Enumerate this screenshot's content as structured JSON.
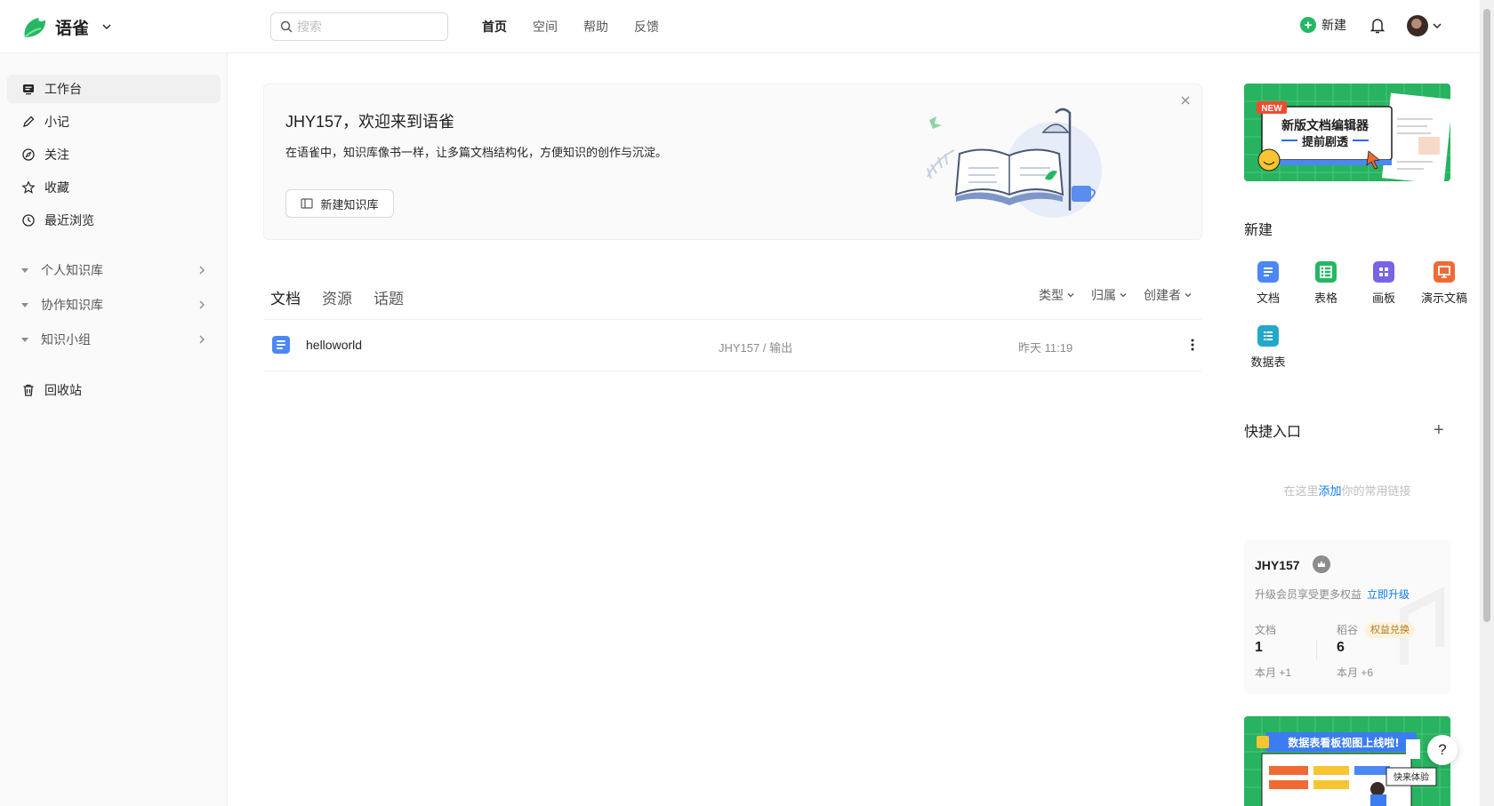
{
  "header": {
    "logo_text": "语雀",
    "search_placeholder": "搜索",
    "nav": [
      "首页",
      "空间",
      "帮助",
      "反馈"
    ],
    "new_label": "新建"
  },
  "sidebar": {
    "items": [
      {
        "label": "工作台",
        "icon": "workbench-icon"
      },
      {
        "label": "小记",
        "icon": "pen-icon"
      },
      {
        "label": "关注",
        "icon": "compass-icon"
      },
      {
        "label": "收藏",
        "icon": "star-icon"
      },
      {
        "label": "最近浏览",
        "icon": "clock-icon"
      }
    ],
    "groups": [
      "个人知识库",
      "协作知识库",
      "知识小组"
    ],
    "trash": "回收站"
  },
  "banner": {
    "title": "JHY157，欢迎来到语雀",
    "desc": "在语雀中，知识库像书一样，让多篇文档结构化，方便知识的创作与沉淀。",
    "button": "新建知识库"
  },
  "list": {
    "tabs": [
      "文档",
      "资源",
      "话题"
    ],
    "filters": [
      "类型",
      "归属",
      "创建者"
    ],
    "rows": [
      {
        "name": "helloworld",
        "path": "JHY157 / 输出",
        "time": "昨天 11:19"
      }
    ]
  },
  "right": {
    "promo1": {
      "badge": "NEW",
      "line1": "新版文档编辑器",
      "line2": "提前剧透"
    },
    "create_title": "新建",
    "create_items": [
      {
        "label": "文档",
        "color": "#4b88f5"
      },
      {
        "label": "表格",
        "color": "#25b864"
      },
      {
        "label": "画板",
        "color": "#7b63e6"
      },
      {
        "label": "演示文稿",
        "color": "#f06a35"
      },
      {
        "label": "数据表",
        "color": "#23a8c9"
      }
    ],
    "quick_title": "快捷入口",
    "quick_hint_pre": "在这里",
    "quick_hint_link": "添加",
    "quick_hint_post": "你的常用链接",
    "user": {
      "name": "JHY157",
      "upgrade_text": "升级会员享受更多权益",
      "upgrade_link": "立即升级",
      "docs_label": "文档",
      "docs_value": "1",
      "docs_sub": "本月 +1",
      "grain_label": "稻谷",
      "grain_value": "6",
      "grain_sub": "本月 +6",
      "exchange": "权益兑换"
    },
    "promo2": {
      "title": "数据表看板视图上线啦!",
      "cta": "快来体验"
    },
    "help": "?"
  }
}
